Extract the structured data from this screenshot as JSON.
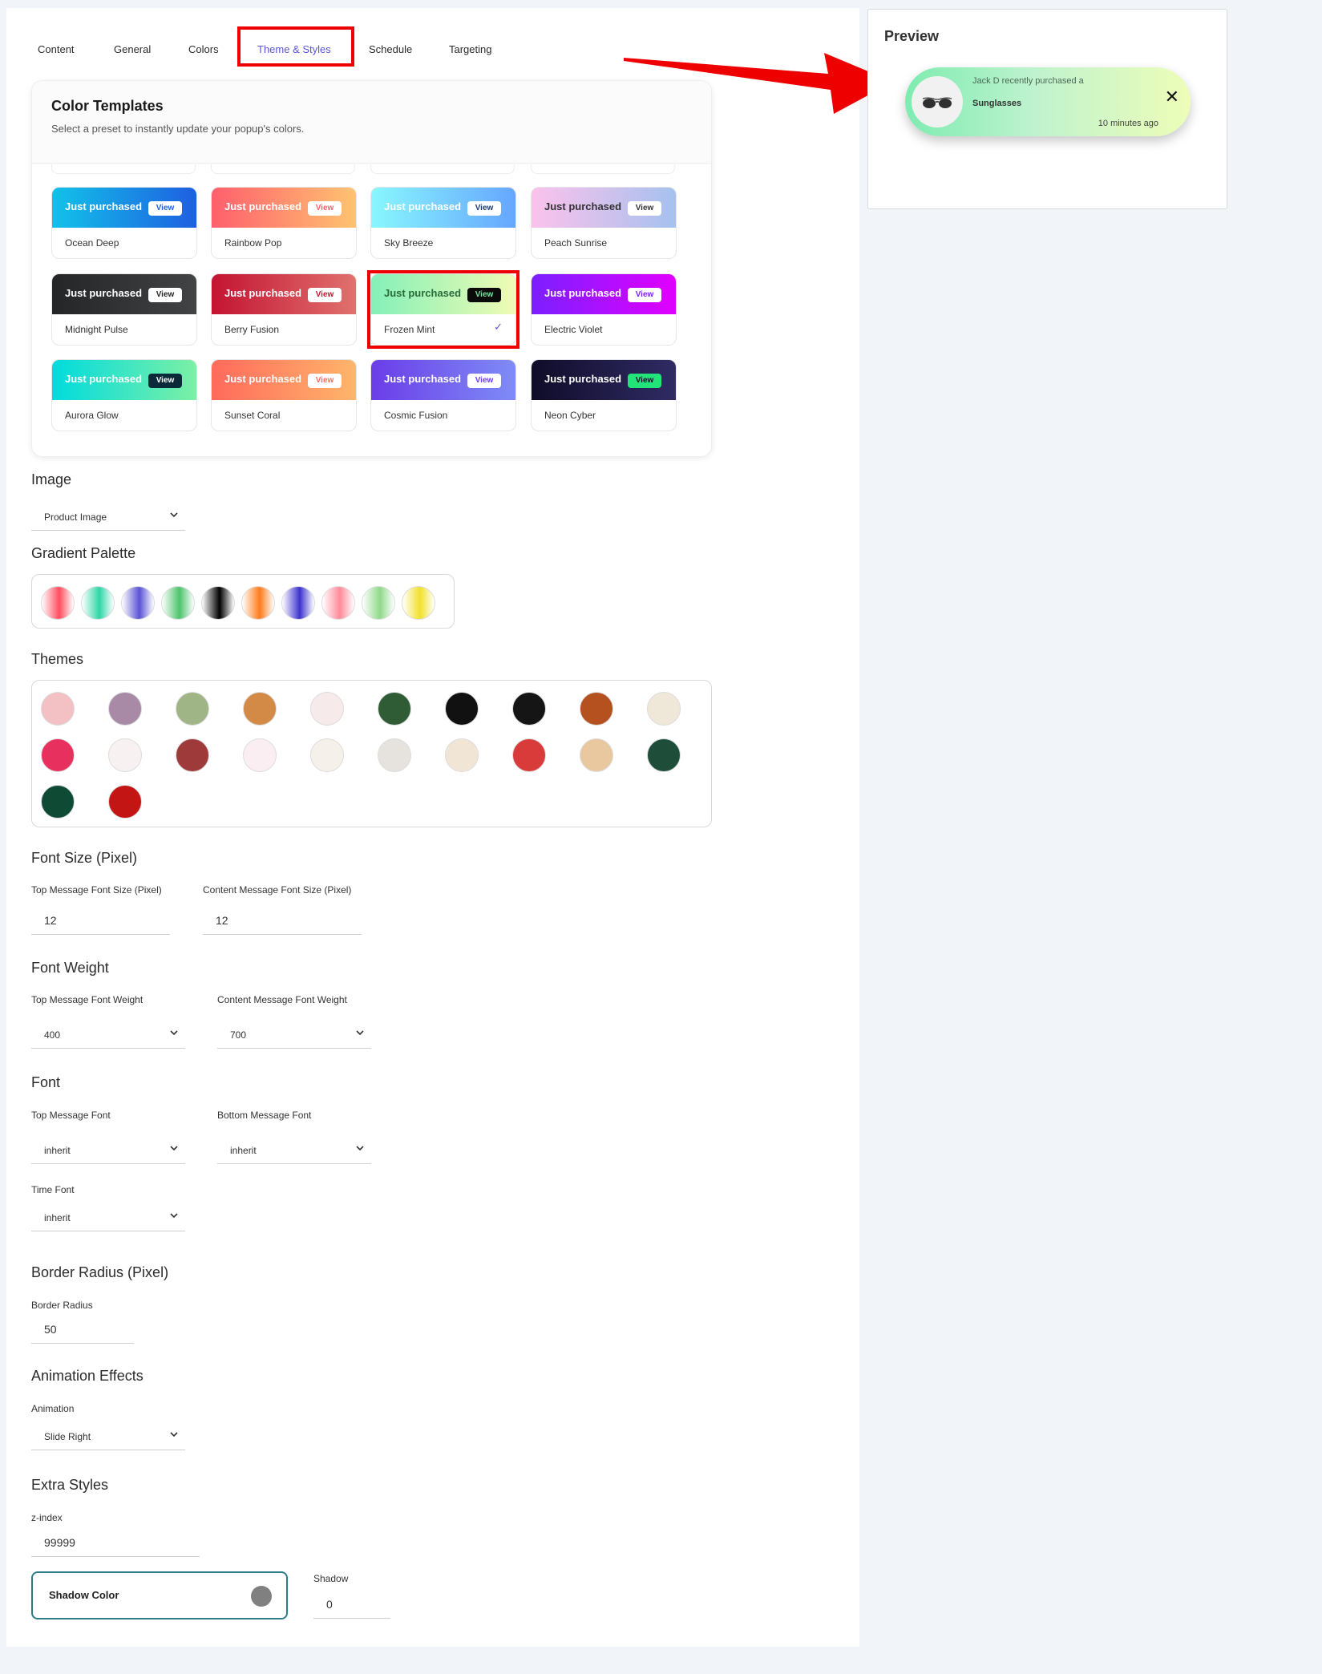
{
  "tabs": [
    {
      "label": "Content"
    },
    {
      "label": "General"
    },
    {
      "label": "Colors"
    },
    {
      "label": "Theme & Styles",
      "active": true
    },
    {
      "label": "Schedule"
    },
    {
      "label": "Targeting"
    }
  ],
  "templates": {
    "title": "Color Templates",
    "subtitle": "Select a preset to instantly update your popup's colors.",
    "band_text": "Just purchased",
    "view_label": "View",
    "selected": "Frozen Mint",
    "items": [
      {
        "name": "Ocean Deep",
        "gradient": [
          "#12c2e9",
          "#1f5fe0"
        ],
        "text_color": "#ffffff",
        "view_bg": "#ffffff",
        "view_color": "#1f5fe0"
      },
      {
        "name": "Rainbow Pop",
        "gradient": [
          "#ff5f6d",
          "#ffc371"
        ],
        "text_color": "#ffffff",
        "view_bg": "#ffffff",
        "view_color": "#ff5f6d"
      },
      {
        "name": "Sky Breeze",
        "gradient": [
          "#89f7fe",
          "#66a6ff"
        ],
        "text_color": "#ffffff",
        "view_bg": "#ffffff",
        "view_color": "#1a3c6e"
      },
      {
        "name": "Peach Sunrise",
        "gradient": [
          "#fbc2eb",
          "#a6c1ee"
        ],
        "text_color": "#333333",
        "view_bg": "#ffffff",
        "view_color": "#333333"
      },
      {
        "name": "Midnight Pulse",
        "gradient": [
          "#232526",
          "#414345"
        ],
        "text_color": "#ffffff",
        "view_bg": "#ffffff",
        "view_color": "#232526"
      },
      {
        "name": "Berry Fusion",
        "gradient": [
          "#c31432",
          "#e0716e"
        ],
        "text_color": "#ffffff",
        "view_bg": "#ffffff",
        "view_color": "#c31432"
      },
      {
        "name": "Frozen Mint",
        "gradient": [
          "#84f0b8",
          "#f0fbb5"
        ],
        "text_color": "#2a6b3a",
        "view_bg": "#0a0a0a",
        "view_color": "#7ee0a0"
      },
      {
        "name": "Electric Violet",
        "gradient": [
          "#7b1fff",
          "#e100ff"
        ],
        "text_color": "#ffffff",
        "view_bg": "#ffffff",
        "view_color": "#7b1fff"
      },
      {
        "name": "Aurora Glow",
        "gradient": [
          "#00dbde",
          "#7cf0a5"
        ],
        "text_color": "#ffffff",
        "view_bg": "#0a2a3a",
        "view_color": "#ffffff"
      },
      {
        "name": "Sunset Coral",
        "gradient": [
          "#ff6a5c",
          "#ffb56b"
        ],
        "text_color": "#ffffff",
        "view_bg": "#ffffff",
        "view_color": "#ff6a5c"
      },
      {
        "name": "Cosmic Fusion",
        "gradient": [
          "#6a3de8",
          "#7f8cf5"
        ],
        "text_color": "#ffffff",
        "view_bg": "#ffffff",
        "view_color": "#6a3de8"
      },
      {
        "name": "Neon Cyber",
        "gradient": [
          "#0f0c29",
          "#302b63"
        ],
        "text_color": "#ffffff",
        "view_bg": "#22e57a",
        "view_color": "#0f0c29"
      }
    ]
  },
  "image_section": {
    "heading": "Image",
    "value": "Product Image"
  },
  "gradient_palette": {
    "heading": "Gradient Palette",
    "swatches": [
      [
        "#ff4d5e",
        "#ffffff"
      ],
      [
        "#2fd6a7",
        "#ffffff"
      ],
      [
        "#5a52d6",
        "#ffffff"
      ],
      [
        "#4cc46a",
        "#ffffff"
      ],
      [
        "#000000",
        "#ffffff"
      ],
      [
        "#ff7b1c",
        "#ffffff"
      ],
      [
        "#3d33cf",
        "#ffffff"
      ],
      [
        "#ff8a99",
        "#ffffff"
      ],
      [
        "#8fd98a",
        "#ffffff"
      ],
      [
        "#f2e02a",
        "#ffffff"
      ]
    ]
  },
  "themes": {
    "heading": "Themes",
    "dots": [
      {
        "icon": "pattern-pink-icon",
        "color": "#f3c0c4"
      },
      {
        "icon": "plain-mauve-icon",
        "color": "#a88aa6"
      },
      {
        "icon": "plain-sage-icon",
        "color": "#9fb585"
      },
      {
        "icon": "plain-orange-icon",
        "color": "#d48a47"
      },
      {
        "icon": "sale-stamp-icon",
        "color": "#f6eaea"
      },
      {
        "icon": "dollar-green-icon",
        "color": "#2f5b35"
      },
      {
        "icon": "geometric-black-icon",
        "color": "#111111"
      },
      {
        "icon": "cart-black-icon",
        "color": "#151515"
      },
      {
        "icon": "pumpkin-icon",
        "color": "#b5501f"
      },
      {
        "icon": "ghost-icon",
        "color": "#efe8d8"
      },
      {
        "icon": "hearts-icon",
        "color": "#e8305e"
      },
      {
        "icon": "snowflake-white-icon",
        "color": "#f8f1f1"
      },
      {
        "icon": "snowflake-red-icon",
        "color": "#9e3a3a"
      },
      {
        "icon": "percent-bag-icon",
        "color": "#fbeef3"
      },
      {
        "icon": "shopping-bag-icon",
        "color": "#f6f0ea"
      },
      {
        "icon": "percent-gray-icon",
        "color": "#e6e3de"
      },
      {
        "icon": "percent-red-icon",
        "color": "#f1e6d6"
      },
      {
        "icon": "ornament-red-icon",
        "color": "#d93a3a"
      },
      {
        "icon": "christmas-tree-icon",
        "color": "#e9c79f"
      },
      {
        "icon": "snowman-icon",
        "color": "#1e4d3a"
      },
      {
        "icon": "plain-dark-green-icon",
        "color": "#0f4a35"
      },
      {
        "icon": "plain-red-icon",
        "color": "#c41515"
      }
    ]
  },
  "font_size": {
    "heading": "Font Size (Pixel)",
    "top_label": "Top Message Font Size (Pixel)",
    "top_value": "12",
    "content_label": "Content Message Font Size (Pixel)",
    "content_value": "12"
  },
  "font_weight": {
    "heading": "Font Weight",
    "top_label": "Top Message Font Weight",
    "top_value": "400",
    "content_label": "Content Message Font Weight",
    "content_value": "700"
  },
  "font": {
    "heading": "Font",
    "top_label": "Top Message Font",
    "top_value": "inherit",
    "bottom_label": "Bottom Message Font",
    "bottom_value": "inherit",
    "time_label": "Time Font",
    "time_value": "inherit"
  },
  "border_radius": {
    "heading": "Border Radius (Pixel)",
    "label": "Border Radius",
    "value": "50"
  },
  "animation": {
    "heading": "Animation Effects",
    "label": "Animation",
    "value": "Slide Right"
  },
  "extra": {
    "heading": "Extra Styles",
    "zindex_label": "z-index",
    "zindex_value": "99999",
    "shadow_color_label": "Shadow Color",
    "shadow_color": "#808080",
    "shadow_label": "Shadow",
    "shadow_value": "0"
  },
  "preview": {
    "title": "Preview",
    "top_message": "Jack D recently purchased a",
    "product": "Sunglasses",
    "time": "10 minutes ago"
  },
  "colors": {
    "accent": "#5a54d6",
    "highlight": "#ee0000"
  }
}
